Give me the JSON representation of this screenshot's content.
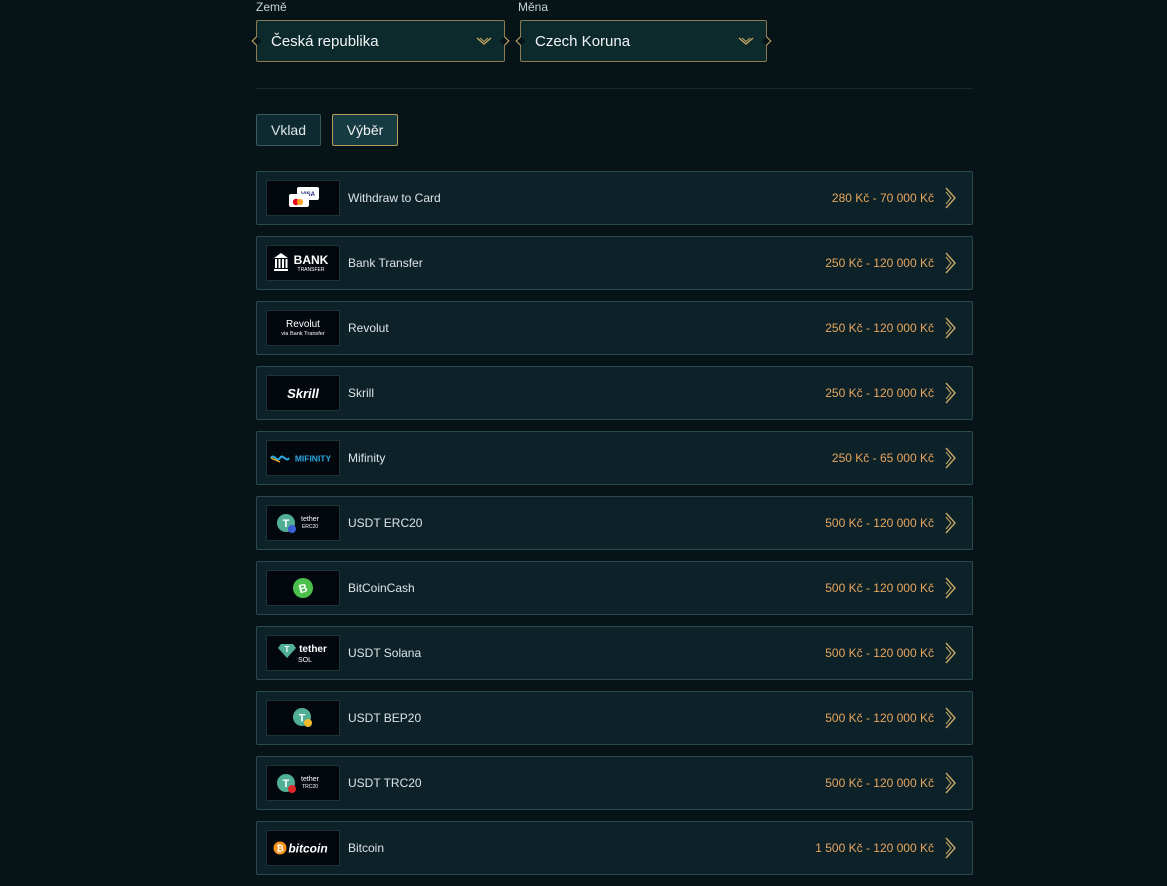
{
  "filters": {
    "country_label": "Země",
    "country_value": "Česká republika",
    "currency_label": "Měna",
    "currency_value": "Czech Koruna"
  },
  "tabs": [
    {
      "label": "Vklad",
      "active": false
    },
    {
      "label": "Výběr",
      "active": true
    }
  ],
  "methods": [
    {
      "name": "Withdraw to Card",
      "range": "280 Kč - 70 000 Kč",
      "logo": "card-icon",
      "logo_text": "VISA"
    },
    {
      "name": "Bank Transfer",
      "range": "250 Kč - 120 000 Kč",
      "logo": "bank-transfer-logo",
      "logo_text": "BANK",
      "logo_subtext": "TRANSFER"
    },
    {
      "name": "Revolut",
      "range": "250 Kč - 120 000 Kč",
      "logo": "revolut-logo",
      "logo_text": "Revolut",
      "logo_subtext": "via Bank Transfer"
    },
    {
      "name": "Skrill",
      "range": "250 Kč - 120 000 Kč",
      "logo": "skrill-logo",
      "logo_text": "Skrill"
    },
    {
      "name": "Mifinity",
      "range": "250 Kč - 65 000 Kč",
      "logo": "mifinity-logo",
      "logo_text": "MIFINITY"
    },
    {
      "name": "USDT ERC20",
      "range": "500 Kč - 120 000 Kč",
      "logo": "tether-erc20-logo",
      "logo_text": "tether",
      "logo_subtext": "ERC20"
    },
    {
      "name": "BitCoinCash",
      "range": "500 Kč - 120 000 Kč",
      "logo": "bitcoincash-logo"
    },
    {
      "name": "USDT Solana",
      "range": "500 Kč - 120 000 Kč",
      "logo": "tether-sol-logo",
      "logo_text": "tether",
      "logo_subtext": "SOL"
    },
    {
      "name": "USDT BEP20",
      "range": "500 Kč - 120 000 Kč",
      "logo": "tether-bep20-logo"
    },
    {
      "name": "USDT TRC20",
      "range": "500 Kč - 120 000 Kč",
      "logo": "tether-trc20-logo",
      "logo_text": "tether",
      "logo_subtext": "TRC20"
    },
    {
      "name": "Bitcoin",
      "range": "1 500 Kč - 120 000 Kč",
      "logo": "bitcoin-logo",
      "logo_text": "bitcoin"
    }
  ],
  "colors": {
    "background": "#061418",
    "accent_gold": "#c9a866",
    "range_orange": "#e8a55f"
  }
}
